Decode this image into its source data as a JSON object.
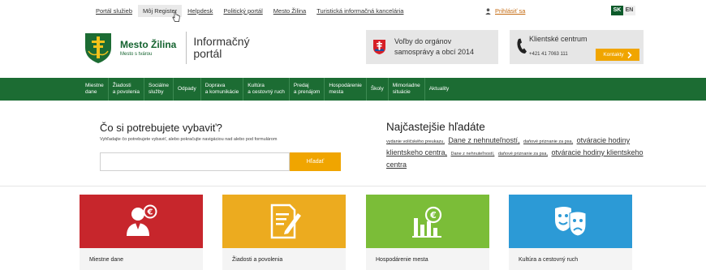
{
  "topbar": {
    "links": [
      "Portál služieb",
      "Môj Register",
      "Helpdesk",
      "Politický portál",
      "Mesto Žilina",
      "Turistická informačná kancelária"
    ],
    "login": "Prihlásiť sa",
    "lang": [
      "SK",
      "EN"
    ]
  },
  "brand": {
    "name": "Mesto Žilina",
    "tagline": "Mesto s tvárou",
    "portal_line1": "Informačný",
    "portal_line2": "portál"
  },
  "election": {
    "line1": "Voľby do orgánov",
    "line2": "samosprávy a obcí 2014"
  },
  "client": {
    "title": "Klientské centrum",
    "phone": "+421 41 7063 111",
    "button": "Kontakty"
  },
  "nav": [
    "Miestne\ndane",
    "Žiadosti\na povolenia",
    "Sociálne\nslužby",
    "Odpady",
    "Doprava\na komunikácie",
    "Kultúra\na cestovný ruch",
    "Predaj\na prenájom",
    "Hospodárenie\nmesta",
    "Školy",
    "Mimoriadne\nsituácie",
    "Aktuality"
  ],
  "search": {
    "title": "Čo si potrebujete vybaviť?",
    "subtitle": "Vyhľadajte čo potrebujete vybaviť, alebo pokračujte navigáciou nad alebo pod formulárom",
    "placeholder": "",
    "button": "Hľadať"
  },
  "most_searched": {
    "title": "Najčastejšie hľadáte",
    "items": [
      {
        "text": "vydanie voličského preukazu,",
        "size": "sm"
      },
      {
        "text": "Dane z nehnuteľností,",
        "size": "lg"
      },
      {
        "text": "daňové priznanie za psa,",
        "size": "sm"
      },
      {
        "text": "otváracie hodiny klientskeho centra,",
        "size": "lg"
      },
      {
        "text": "Dane z nehnuteľností,",
        "size": "sm"
      },
      {
        "text": "daňové priznanie za psa,",
        "size": "sm"
      },
      {
        "text": "otváracie hodiny klientskeho centra",
        "size": "lg"
      }
    ]
  },
  "tiles": [
    {
      "label": "Miestne dane",
      "color": "#c7262c",
      "icon": "tax-person-icon"
    },
    {
      "label": "Žiadosti a povolenia",
      "color": "#ecab1f",
      "icon": "document-pen-icon"
    },
    {
      "label": "Hospodárenie mesta",
      "color": "#7bbd38",
      "icon": "finance-chart-icon"
    },
    {
      "label": "Kultúra a cestovný ruch",
      "color": "#2c9ad6",
      "icon": "theater-masks-icon"
    }
  ],
  "colors": {
    "brand_green": "#1c6c33",
    "accent_orange": "#f0a500",
    "login_link": "#c46a10"
  }
}
